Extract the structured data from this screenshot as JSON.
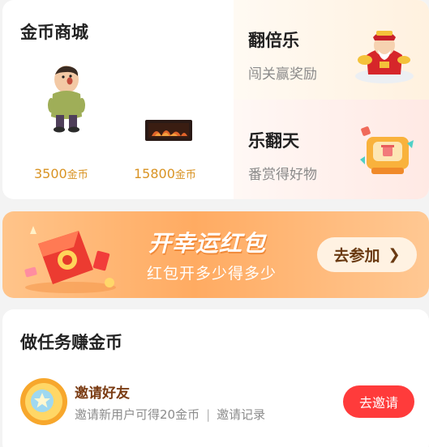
{
  "mall": {
    "title": "金币商城",
    "products": [
      {
        "price": "3500",
        "unit": "金币",
        "icon": "figure-toy-icon"
      },
      {
        "price": "15800",
        "unit": "金币",
        "icon": "fireplace-icon"
      }
    ]
  },
  "promos": [
    {
      "title": "翻倍乐",
      "subtitle": "闯关赢奖励",
      "icon": "fortune-god-icon"
    },
    {
      "title": "乐翻天",
      "subtitle": "番赏得好物",
      "icon": "gift-machine-icon"
    }
  ],
  "banner": {
    "title": "开幸运红包",
    "subtitle": "红包开多少得多少",
    "button_label": "去参加",
    "icon": "red-envelope-icon"
  },
  "tasks": {
    "title": "做任务赚金币",
    "items": [
      {
        "name": "邀请好友",
        "desc": "邀请新用户可得20金币",
        "separator": "|",
        "link": "邀请记录",
        "button_label": "去邀请",
        "icon": "coin-star-icon"
      }
    ]
  },
  "colors": {
    "price": "#d99323",
    "accent_red": "#ff3b3b",
    "banner_orange": "#ffab62"
  }
}
